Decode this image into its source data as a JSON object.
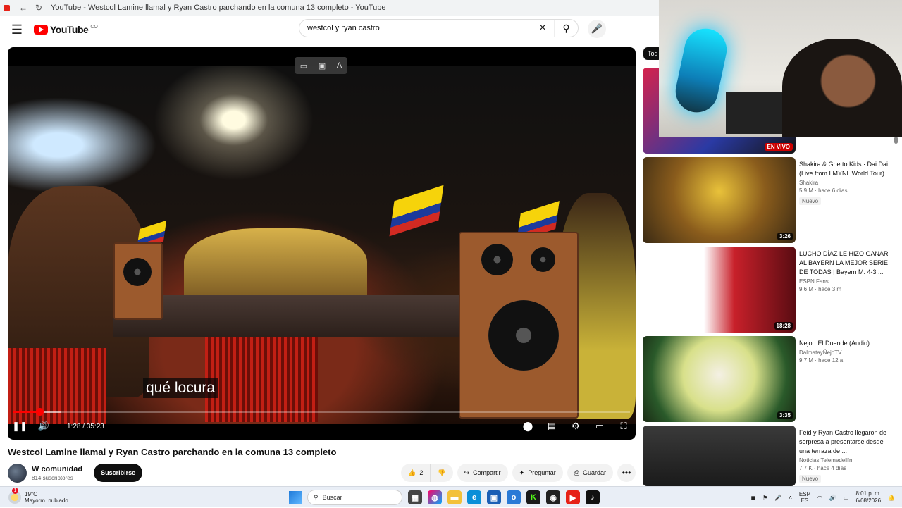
{
  "browser": {
    "tab_title": "YouTube - Westcol Lamine llamal y Ryan Castro parchando en la comuna 13 completo - YouTube"
  },
  "masthead": {
    "logo": "YouTube",
    "country_code": "CO",
    "search_value": "westcol y ryan castro"
  },
  "player": {
    "subtitle": "qué locura",
    "time": "1:28 / 35:23",
    "progress_fraction": 0.042,
    "buffered_fraction": 0.078
  },
  "video": {
    "title": "Westcol Lamine llamal y Ryan Castro parchando en la comuna 13 completo",
    "channel": "W comunidad",
    "subscribers": "814 suscriptores",
    "subscribe_label": "Suscribirse",
    "likes": "2",
    "share_label": "Compartir",
    "ask_label": "Preguntar",
    "save_label": "Guardar"
  },
  "sidebar": {
    "chip": "Tod",
    "items": [
      {
        "title": "",
        "channel": "",
        "stats": "",
        "badge": "",
        "overlay": "EN VIVO",
        "live": true
      },
      {
        "title": "Shakira & Ghetto Kids · Dai Dai (Live from LMYNL World Tour)",
        "channel": "Shakira",
        "stats": "5.9 M · hace 6 días",
        "badge": "Nuevo",
        "overlay": "3:26"
      },
      {
        "title": "LUCHO DÍAZ LE HIZO GANAR AL BAYERN LA MEJOR SERIE DE TODAS | Bayern M. 4-3 ...",
        "channel": "ESPN Fans",
        "stats": "9.6 M · hace 3 m",
        "badge": "",
        "overlay": "18:28"
      },
      {
        "title": "Ñejo · El Duende (Audio)",
        "channel": "DalmatayÑejoTV",
        "stats": "9.7 M · hace 12 a",
        "badge": "",
        "overlay": "3:35"
      },
      {
        "title": "Feid y Ryan Castro llegaron de sorpresa a presentarse desde una terraza de ...",
        "channel": "Noticias Telemedellín",
        "stats": "7.7 K · hace 4 días",
        "badge": "Nuevo",
        "overlay": ""
      }
    ]
  },
  "taskbar": {
    "temp": "19°C",
    "weather": "Mayorm. nublado",
    "search_placeholder": "Buscar",
    "lang_top": "ESP",
    "lang_bottom": "ES",
    "time": "8:01 p. m.",
    "date": "6/08/2026"
  }
}
